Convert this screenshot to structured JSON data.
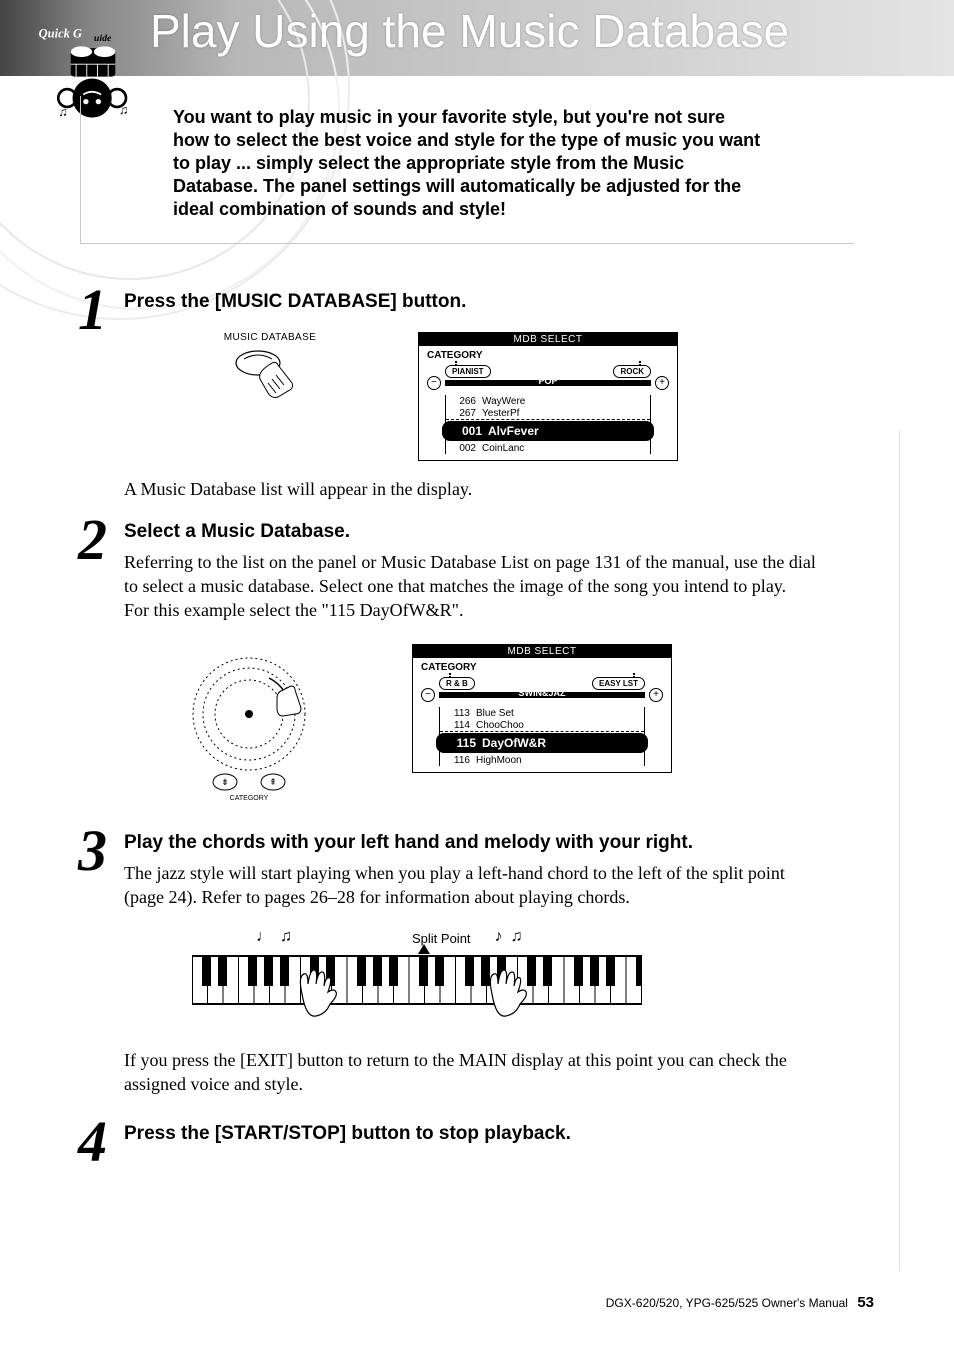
{
  "header": {
    "quick_guide_label": "Quick Guide",
    "title": "Play Using the Music Database",
    "intro": "You want to play music in your favorite style, but you're not sure how to select the best voice and style for the type of music you want to play ... simply select the appropriate style from the Music Database. The panel settings will automatically be adjusted for the ideal combination of sounds and style!"
  },
  "steps": [
    {
      "number": "1",
      "heading": "Press the [MUSIC DATABASE] button.",
      "button_label": "MUSIC DATABASE",
      "lcd": {
        "title": "MDB SELECT",
        "category_label": "CATEGORY",
        "left_tab": "PIANIST",
        "right_tab": "ROCK",
        "center": "POP",
        "knob_minus": "−",
        "knob_plus": "+",
        "rows": [
          {
            "num": "266",
            "name": "WayWere"
          },
          {
            "num": "267",
            "name": "YesterPf"
          },
          {
            "num": "001",
            "name": "AlvFever",
            "selected": true
          },
          {
            "num": "002",
            "name": "CoinLanc"
          }
        ]
      },
      "caption": "A Music Database list will appear in the display."
    },
    {
      "number": "2",
      "heading": "Select a Music Database.",
      "body": "Referring to the list on the panel or Music Database List on page 131 of the manual, use the dial to select a music database. Select one that matches the image of the song you intend to play.\nFor this example select the \"115 DayOfW&R\".",
      "dial_label": "CATEGORY",
      "lcd": {
        "title": "MDB SELECT",
        "category_label": "CATEGORY",
        "left_tab": "R & B",
        "right_tab": "EASY LST",
        "center": "SWIN&JAZ",
        "knob_minus": "−",
        "knob_plus": "+",
        "rows": [
          {
            "num": "113",
            "name": "Blue Set"
          },
          {
            "num": "114",
            "name": "ChooChoo"
          },
          {
            "num": "115",
            "name": "DayOfW&R",
            "selected": true
          },
          {
            "num": "116",
            "name": "HighMoon"
          }
        ]
      }
    },
    {
      "number": "3",
      "heading": "Play the chords with your left hand and melody with your right.",
      "body": "The jazz style will start playing when you play a left-hand chord to the left of the split point (page 24). Refer to pages 26–28 for information about playing chords.",
      "split_label": "Split Point",
      "after": "If you press the [EXIT] button to return to the MAIN display at this point you can check the assigned voice and style."
    },
    {
      "number": "4",
      "heading": "Press the [START/STOP] button to stop playback."
    }
  ],
  "footer": {
    "manual": "DGX-620/520, YPG-625/525  Owner's Manual",
    "page": "53"
  }
}
